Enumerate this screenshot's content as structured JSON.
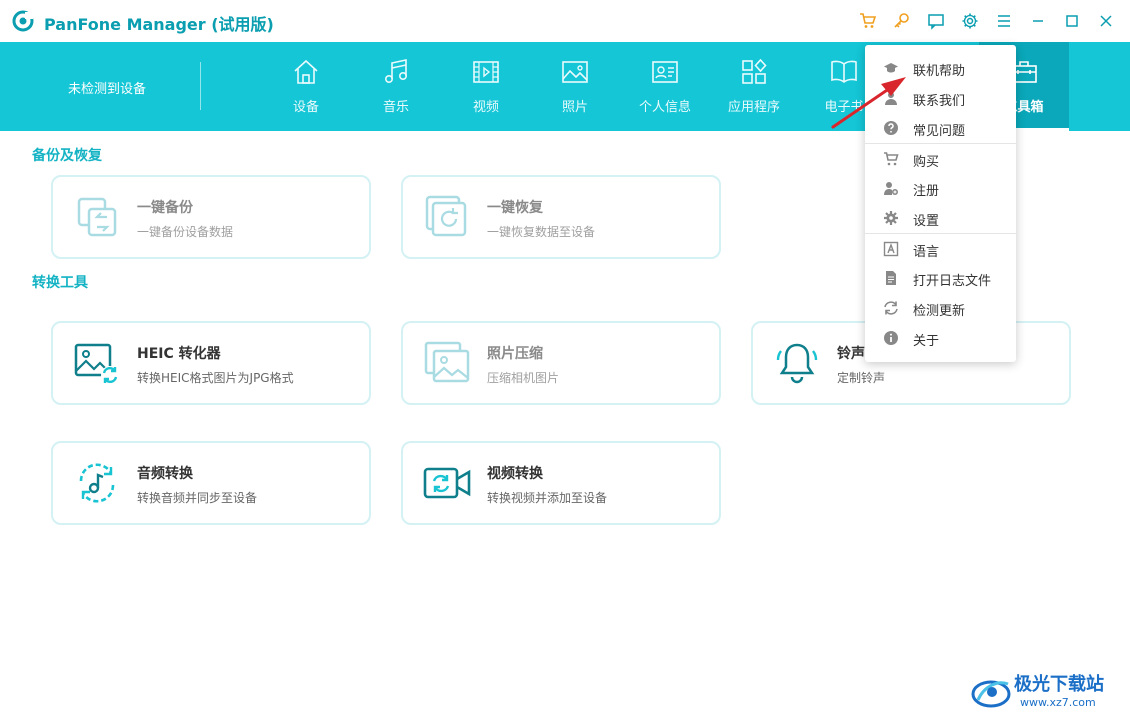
{
  "app": {
    "title": "PanFone Manager (试用版)"
  },
  "titlebar_icons": [
    "cart-icon",
    "key-icon",
    "feedback-icon",
    "gear-icon",
    "menu-icon",
    "minimize-icon",
    "maximize-icon",
    "close-icon"
  ],
  "nav": {
    "device_status": "未检测到设备",
    "items": [
      {
        "label": "设备",
        "icon": "home-icon"
      },
      {
        "label": "音乐",
        "icon": "music-icon"
      },
      {
        "label": "视频",
        "icon": "video-icon"
      },
      {
        "label": "照片",
        "icon": "photo-icon"
      },
      {
        "label": "个人信息",
        "icon": "contact-icon"
      },
      {
        "label": "应用程序",
        "icon": "apps-icon"
      },
      {
        "label": "电子书",
        "icon": "book-icon"
      },
      {
        "label": "工具箱",
        "icon": "toolbox-icon"
      }
    ]
  },
  "sections": {
    "backup": {
      "title": "备份及恢复",
      "cards": [
        {
          "title": "一键备份",
          "desc": "一键备份设备数据"
        },
        {
          "title": "一键恢复",
          "desc": "一键恢复数据至设备"
        }
      ]
    },
    "convert": {
      "title": "转换工具",
      "cards": [
        {
          "title": "HEIC 转化器",
          "desc": "转换HEIC格式图片为JPG格式"
        },
        {
          "title": "照片压缩",
          "desc": "压缩相机图片"
        },
        {
          "title": "铃声",
          "desc": "定制铃声"
        },
        {
          "title": "音频转换",
          "desc": "转换音频并同步至设备"
        },
        {
          "title": "视频转换",
          "desc": "转换视频并添加至设备"
        }
      ]
    }
  },
  "menu": {
    "items": [
      {
        "label": "联机帮助",
        "icon": "graduation-cap-icon"
      },
      {
        "label": "联系我们",
        "icon": "contact-us-icon"
      },
      {
        "label": "常见问题",
        "icon": "question-icon"
      },
      {
        "label": "购买",
        "icon": "cart-icon"
      },
      {
        "label": "注册",
        "icon": "register-icon"
      },
      {
        "label": "设置",
        "icon": "gear-icon"
      },
      {
        "label": "语言",
        "icon": "language-icon"
      },
      {
        "label": "打开日志文件",
        "icon": "log-file-icon"
      },
      {
        "label": "检测更新",
        "icon": "refresh-icon"
      },
      {
        "label": "关于",
        "icon": "info-icon"
      }
    ]
  },
  "watermark": {
    "name": "极光下载站",
    "url": "www.xz7.com"
  },
  "colors": {
    "accent": "#14c6d6",
    "accent_dark": "#0aa8ba",
    "title": "#0a9eb0",
    "arrow": "#d8262c"
  }
}
